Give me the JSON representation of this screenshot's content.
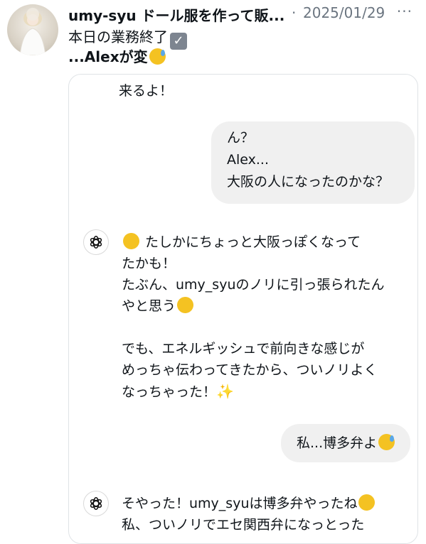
{
  "post": {
    "author": "umy-syu ドール服を作って販...",
    "separator": "·",
    "date": "2025/01/29",
    "more": "···",
    "line1": "本日の業務終了",
    "line2": "...Alexが変"
  },
  "chat": {
    "top_fragment": "来るよ！",
    "user_msg_1": [
      "ん？",
      "Alex...",
      "大阪の人になったのかな？"
    ],
    "ai_msg_1_first": "たしかにちょっと大阪っぽくなって",
    "ai_msg_1_rest": [
      "たかも！",
      "たぶん、umy_syuのノリに引っ張られたん"
    ],
    "ai_msg_1_line4": "やと思う",
    "ai_msg_1_para2": [
      "でも、エネルギッシュで前向きな感じが",
      "めっちゃ伝わってきたから、ついノリよく"
    ],
    "ai_msg_1_last": "なっちゃった！",
    "user_msg_2": "私...博多弁よ",
    "ai_msg_2_first": "そやった！umy_syuは博多弁やったね",
    "ai_msg_2_second": "私、ついノリでエセ関西弁になっとった"
  },
  "icons": {
    "check": "heavy-check-mark-emoji",
    "sweat": "grinning-face-with-sweat-emoji",
    "rofl": "rolling-on-floor-laughing-emoji",
    "sparkles": "sparkles-emoji",
    "assistant": "chatgpt-logo-icon"
  }
}
